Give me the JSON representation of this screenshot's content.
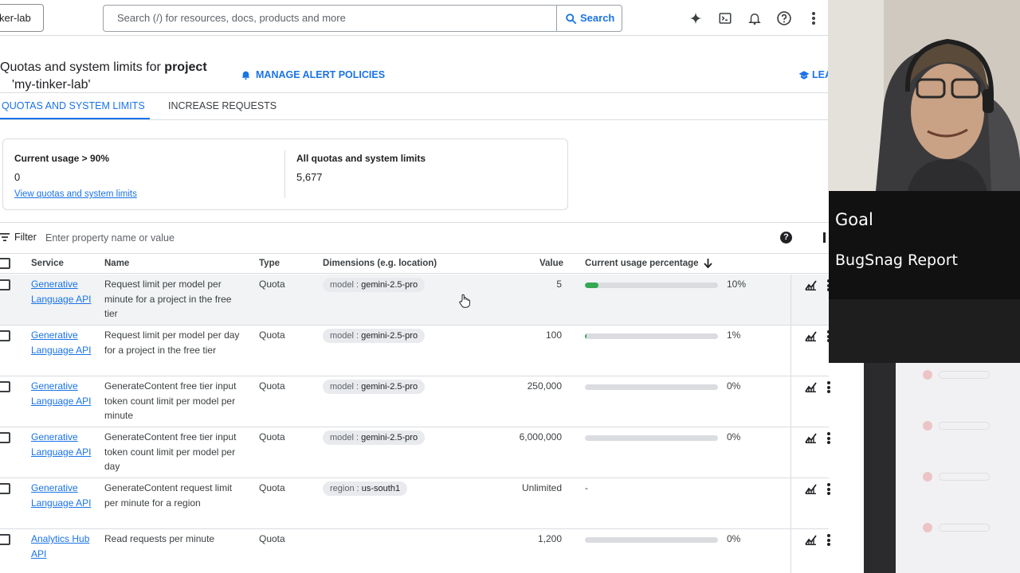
{
  "topbar": {
    "project_chip": "ker-lab",
    "search_placeholder": "Search (/) for resources, docs, products and more",
    "search_button": "Search",
    "icons": [
      "gemini-icon",
      "cloud-shell-icon",
      "notifications-icon",
      "help-icon",
      "more-vert-icon"
    ]
  },
  "header": {
    "title_prefix": "Quotas and system limits for ",
    "title_bold": "project",
    "title_line2": "'my-tinker-lab'",
    "manage_alerts": "MANAGE ALERT POLICIES",
    "learn": "LEA"
  },
  "tabs": [
    {
      "label": "QUOTAS AND SYSTEM LIMITS",
      "active": true
    },
    {
      "label": "INCREASE REQUESTS",
      "active": false
    }
  ],
  "summary": {
    "usage_label": "Current usage > 90%",
    "usage_value": "0",
    "usage_link": "View quotas and system limits",
    "all_label": "All quotas and system limits",
    "all_value": "5,677"
  },
  "filter": {
    "label": "Filter",
    "placeholder": "Enter property name or value"
  },
  "table": {
    "headers": {
      "service": "Service",
      "name": "Name",
      "type": "Type",
      "dimensions": "Dimensions (e.g. location)",
      "value": "Value",
      "usage": "Current usage percentage"
    },
    "rows": [
      {
        "service": "Generative Language API",
        "name": "Request limit per model per minute for a project in the free tier",
        "type": "Quota",
        "dim_key": "model",
        "dim_value": "gemini-2.5-pro",
        "value": "5",
        "usage_pct": "10%",
        "usage_fraction": 0.1
      },
      {
        "service": "Generative Language API",
        "name": "Request limit per model per day for a project in the free tier",
        "type": "Quota",
        "dim_key": "model",
        "dim_value": "gemini-2.5-pro",
        "value": "100",
        "usage_pct": "1%",
        "usage_fraction": 0.01
      },
      {
        "service": "Generative Language API",
        "name": "GenerateContent free tier input token count limit per model per minute",
        "type": "Quota",
        "dim_key": "model",
        "dim_value": "gemini-2.5-pro",
        "value": "250,000",
        "usage_pct": "0%",
        "usage_fraction": 0
      },
      {
        "service": "Generative Language API",
        "name": "GenerateContent free tier input token count limit per model per day",
        "type": "Quota",
        "dim_key": "model",
        "dim_value": "gemini-2.5-pro",
        "value": "6,000,000",
        "usage_pct": "0%",
        "usage_fraction": 0
      },
      {
        "service": "Generative Language API",
        "name": "GenerateContent request limit per minute for a region",
        "type": "Quota",
        "dim_key": "region",
        "dim_value": "us-south1",
        "value": "Unlimited",
        "usage_pct": "-",
        "usage_fraction": null
      },
      {
        "service": "Analytics Hub API",
        "name": "Read requests per minute",
        "type": "Quota",
        "dim_key": "",
        "dim_value": "",
        "value": "1,200",
        "usage_pct": "0%",
        "usage_fraction": 0
      }
    ]
  },
  "overlay": {
    "goal_title": "Goal",
    "goal_text": "BugSnag Report"
  },
  "colors": {
    "accent": "#1a73e8",
    "usage_fill": "#34a853",
    "overlay_bg": "#111111"
  }
}
